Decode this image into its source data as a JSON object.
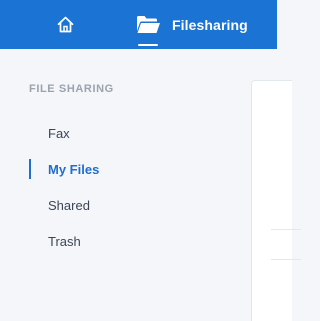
{
  "header": {
    "home_icon": "home-icon",
    "files_icon": "folder-open-icon",
    "files_label": "Filesharing",
    "bg_color": "#1b73d3"
  },
  "sidebar": {
    "section_title": "FILE SHARING",
    "items": [
      {
        "label": "Fax",
        "active": false
      },
      {
        "label": "My Files",
        "active": true
      },
      {
        "label": "Shared",
        "active": false
      },
      {
        "label": "Trash",
        "active": false
      }
    ],
    "accent_color": "#1f6fd0"
  }
}
